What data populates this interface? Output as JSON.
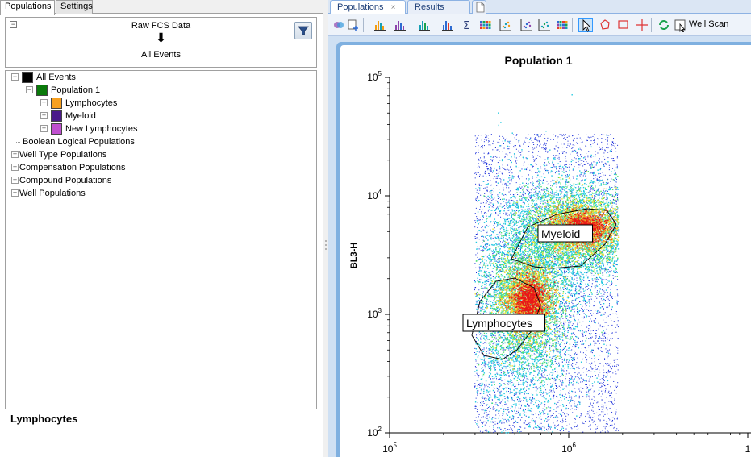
{
  "left_tabs": [
    {
      "label": "Populations",
      "active": true
    },
    {
      "label": "Settings",
      "active": false
    }
  ],
  "filter_panel": {
    "source": "Raw FCS Data",
    "arrow": "🠗",
    "target": "All Events",
    "filter_icon": "funnel-icon"
  },
  "tree": [
    {
      "label": "All Events",
      "color": "#000000",
      "expander": "⊟",
      "level": 0
    },
    {
      "label": "Population 1",
      "color": "#0a7a0a",
      "expander": "⊟",
      "level": 1
    },
    {
      "label": "Lymphocytes",
      "color": "#f7a020",
      "expander": "⊞",
      "level": 2
    },
    {
      "label": "Myeloid",
      "color": "#4a1a8a",
      "expander": "⊞",
      "level": 2
    },
    {
      "label": "New Lymphocytes",
      "color": "#c050d0",
      "expander": "⊞",
      "level": 2
    },
    {
      "label": "Boolean Logical Populations",
      "color": null,
      "expander": "",
      "level": 0
    },
    {
      "label": "Well Type Populations",
      "color": null,
      "expander": "⊞",
      "level": 0
    },
    {
      "label": "Compensation Populations",
      "color": null,
      "expander": "⊞",
      "level": 0
    },
    {
      "label": "Compound Populations",
      "color": null,
      "expander": "⊞",
      "level": 0
    },
    {
      "label": "Well Populations",
      "color": null,
      "expander": "⊞",
      "level": 0
    }
  ],
  "selected_population": "Lymphocytes",
  "right_tabs": [
    {
      "label": "Populations",
      "active": true,
      "close": "×"
    },
    {
      "label": "Results",
      "active": false,
      "close": ""
    }
  ],
  "toolbar": {
    "well_scan_label": "Well Scan"
  },
  "plot": {
    "title": "Population 1",
    "ylabel": "BL3-H",
    "y_ticks": [
      {
        "base": "10",
        "exp": "5"
      },
      {
        "base": "10",
        "exp": "4"
      },
      {
        "base": "10",
        "exp": "3"
      },
      {
        "base": "10",
        "exp": "2"
      }
    ],
    "x_ticks": [
      {
        "base": "10",
        "exp": "5"
      },
      {
        "base": "10",
        "exp": "6"
      },
      {
        "base": "1",
        "exp": ""
      }
    ],
    "gates": [
      {
        "label": "Myeloid"
      },
      {
        "label": "Lymphocytes"
      }
    ],
    "x_scale": "log",
    "y_scale": "log"
  }
}
